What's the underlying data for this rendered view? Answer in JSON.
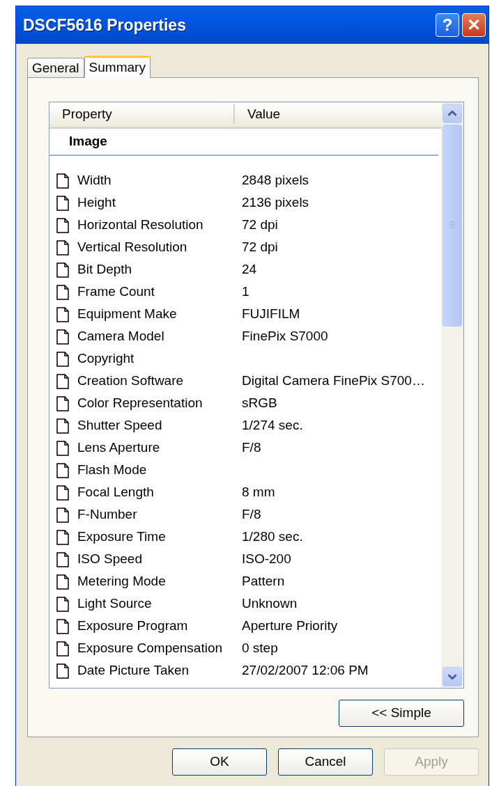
{
  "window": {
    "title": "DSCF5616 Properties"
  },
  "title_buttons": [
    {
      "label": "?",
      "kind": "help"
    },
    {
      "label": "✕",
      "kind": "close"
    }
  ],
  "tabs": [
    {
      "label": "General",
      "selected": false
    },
    {
      "label": "Summary",
      "selected": true
    }
  ],
  "table": {
    "columns": [
      "Property",
      "Value"
    ],
    "group": "Image",
    "rows": [
      {
        "property": "Width",
        "value": "2848 pixels"
      },
      {
        "property": "Height",
        "value": "2136 pixels"
      },
      {
        "property": "Horizontal Resolution",
        "value": "72 dpi"
      },
      {
        "property": "Vertical Resolution",
        "value": "72 dpi"
      },
      {
        "property": "Bit Depth",
        "value": "24"
      },
      {
        "property": "Frame Count",
        "value": "1"
      },
      {
        "property": "Equipment Make",
        "value": "FUJIFILM"
      },
      {
        "property": "Camera Model",
        "value": "FinePix S7000"
      },
      {
        "property": "Copyright"
      },
      {
        "property": "Creation Software",
        "value": "Digital Camera FinePix S700…"
      },
      {
        "property": "Color Representation",
        "value": "sRGB"
      },
      {
        "property": "Shutter Speed",
        "value": "1/274 sec."
      },
      {
        "property": "Lens Aperture",
        "value": "F/8"
      },
      {
        "property": "Flash Mode"
      },
      {
        "property": "Focal Length",
        "value": "8 mm"
      },
      {
        "property": "F-Number",
        "value": "F/8"
      },
      {
        "property": "Exposure Time",
        "value": "1/280 sec."
      },
      {
        "property": "ISO Speed",
        "value": "ISO-200"
      },
      {
        "property": "Metering Mode",
        "value": "Pattern"
      },
      {
        "property": "Light Source",
        "value": "Unknown"
      },
      {
        "property": "Exposure Program",
        "value": "Aperture Priority"
      },
      {
        "property": "Exposure Compensation",
        "value": "0 step"
      },
      {
        "property": "Date Picture Taken",
        "value": "27/02/2007 12:06 PM"
      }
    ]
  },
  "simple_button": {
    "label": "<< Simple"
  },
  "buttons": [
    {
      "label": "OK",
      "disabled": false
    },
    {
      "label": "Cancel",
      "disabled": false
    },
    {
      "label": "Apply",
      "disabled": true
    }
  ]
}
